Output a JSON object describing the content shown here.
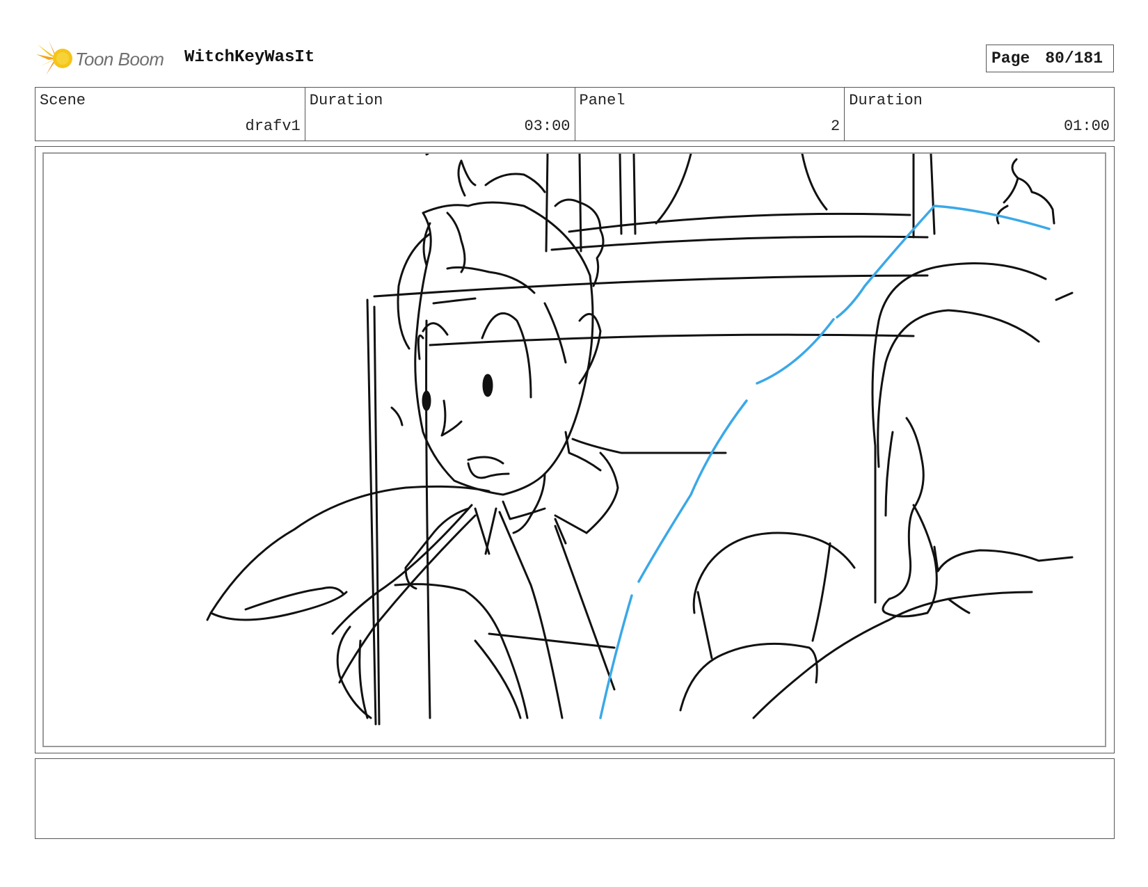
{
  "header": {
    "brand_name": "Toon Boom",
    "project_title": "WitchKeyWasIt",
    "page_label": "Page",
    "page_number": "80/181"
  },
  "info": [
    {
      "label": "Scene",
      "value": "drafv1"
    },
    {
      "label": "Duration",
      "value": "03:00"
    },
    {
      "label": "Panel",
      "value": "2"
    },
    {
      "label": "Duration",
      "value": "01:00"
    }
  ],
  "panel": {
    "line_color": "#111111",
    "accent_line_color": "#3aa8e8"
  },
  "notes": {
    "text": ""
  },
  "colors": {
    "logo_yellow": "#f5c518",
    "logo_orange": "#f08c1a",
    "border": "#555555"
  }
}
